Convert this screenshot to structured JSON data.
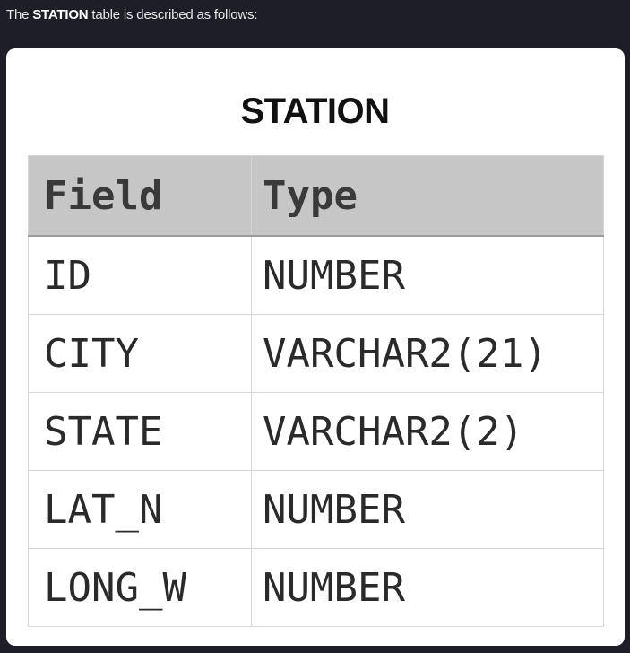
{
  "intro": {
    "before": "The ",
    "table_name": "STATION",
    "after": " table is described as follows:"
  },
  "table": {
    "title": "STATION",
    "headers": {
      "field": "Field",
      "type": "Type"
    },
    "rows": [
      {
        "field": "ID",
        "type": "NUMBER"
      },
      {
        "field": "CITY",
        "type": "VARCHAR2(21)"
      },
      {
        "field": "STATE",
        "type": "VARCHAR2(2)"
      },
      {
        "field": "LAT_N",
        "type": "NUMBER"
      },
      {
        "field": "LONG_W",
        "type": "NUMBER"
      }
    ]
  },
  "colors": {
    "page_background": "#1e1f26",
    "card_background": "#ffffff",
    "header_background": "#c6c6c6"
  }
}
